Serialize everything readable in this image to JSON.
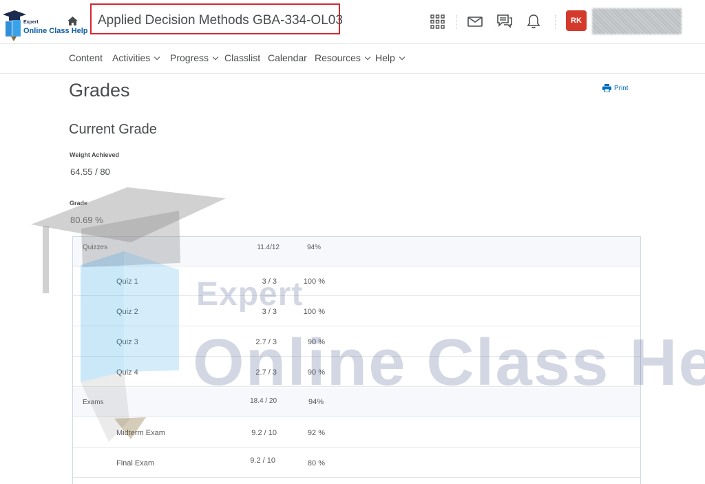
{
  "logo": {
    "line1": "Expert",
    "line2": "Online Class Help"
  },
  "header": {
    "course_title": "Applied Decision Methods GBA-334-OL03",
    "avatar_initials": "RK",
    "icons": [
      "grid-icon",
      "mail-icon",
      "chat-icon",
      "bell-icon"
    ]
  },
  "nav": {
    "items": [
      {
        "label": "Content",
        "dropdown": false
      },
      {
        "label": "Activities",
        "dropdown": true
      },
      {
        "label": "Progress",
        "dropdown": true
      },
      {
        "label": "Classlist",
        "dropdown": false
      },
      {
        "label": "Calendar",
        "dropdown": false
      },
      {
        "label": "Resources",
        "dropdown": true
      },
      {
        "label": "Help",
        "dropdown": true
      }
    ]
  },
  "page": {
    "title": "Grades",
    "print_label": "Print",
    "current_grade_heading": "Current Grade",
    "weight_label": "Weight Achieved",
    "weight_value": "64.55 / 80",
    "grade_label": "Grade",
    "grade_value": "80.69 %"
  },
  "grades": {
    "rows": [
      {
        "name": "Quizzes",
        "points": "11.4/12",
        "percent": "94%",
        "category": true
      },
      {
        "name": "Quiz 1",
        "points": "3 / 3",
        "percent": "100 %",
        "category": false
      },
      {
        "name": "Quiz 2",
        "points": "3 / 3",
        "percent": "100 %",
        "category": false
      },
      {
        "name": "Quiz 3",
        "points": "2.7 / 3",
        "percent": "90 %",
        "category": false
      },
      {
        "name": "Quiz 4",
        "points": "2.7 / 3",
        "percent": "90 %",
        "category": false
      },
      {
        "name": "Exams",
        "points": "18.4 / 20",
        "percent": "94%",
        "category": true
      },
      {
        "name": "Midterm Exam",
        "points": "9.2 / 10",
        "percent": "92 %",
        "category": false
      },
      {
        "name": "Final Exam",
        "points": "9.2 / 10",
        "percent": "80 %",
        "category": false
      }
    ]
  },
  "watermark": {
    "line1": "Expert",
    "line2": "Online Class Help"
  },
  "colors": {
    "title_box": "#d6262e",
    "avatar": "#d33a2c",
    "link": "#006fbf",
    "category_row": "#f6f8fc"
  }
}
